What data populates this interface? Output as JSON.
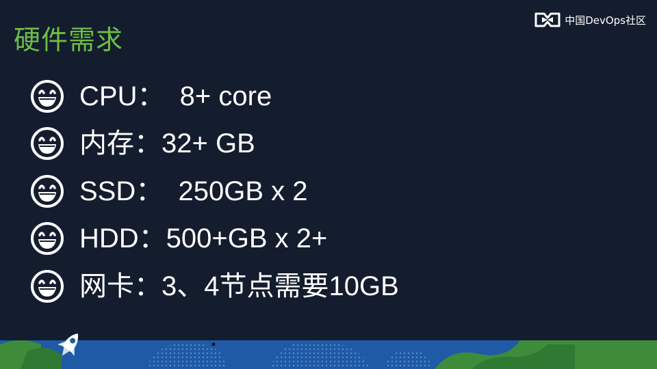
{
  "slide": {
    "title": "硬件需求",
    "logo": {
      "text": "中国DevOps社区",
      "icon": "devops-community-logo-icon"
    },
    "bullet_icon": "grinning-face-icon",
    "bullets": [
      {
        "text": "CPU：  8+ core"
      },
      {
        "text": "内存：32+ GB"
      },
      {
        "text": "SSD：  250GB x 2"
      },
      {
        "text": "HDD：500+GB x 2+"
      },
      {
        "text": "网卡：3、4节点需要10GB"
      }
    ],
    "footer_icon": "rocket-icon"
  },
  "colors": {
    "background": "#131d2e",
    "title": "#6ebd45",
    "text": "#ffffff",
    "footer_blue": "#1f5aa6",
    "footer_green": "#3e8b3a"
  }
}
